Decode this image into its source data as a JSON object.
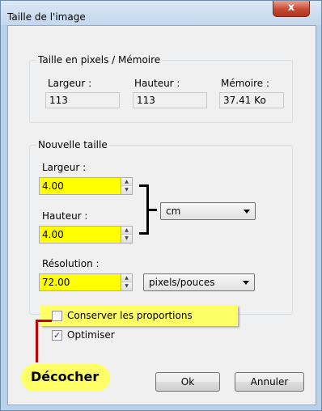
{
  "window": {
    "title": "Taille de l'image",
    "close_glyph": "x"
  },
  "pixels_group": {
    "legend": "Taille en pixels / Mémoire",
    "width_label": "Largeur :",
    "height_label": "Hauteur :",
    "memory_label": "Mémoire :",
    "width_value": "113",
    "height_value": "113",
    "memory_value": "37.41 Ko"
  },
  "new_size_group": {
    "legend": "Nouvelle taille",
    "width_label": "Largeur :",
    "width_value": "4.00",
    "height_label": "Hauteur :",
    "height_value": "4.00",
    "unit_selected": "cm",
    "resolution_label": "Résolution :",
    "resolution_value": "72.00",
    "resolution_unit_selected": "pixels/pouces"
  },
  "options": {
    "keep_proportions_label": "Conserver les proportions",
    "keep_proportions_checked": false,
    "optimize_label": "Optimiser",
    "optimize_checked": true
  },
  "callout": {
    "text": "Décocher",
    "highlight_color": "#ffff66",
    "line_color": "#c00000"
  },
  "buttons": {
    "ok_label": "Ok",
    "cancel_label": "Annuler"
  },
  "icons": {
    "spin_up": "▲",
    "spin_down": "▼",
    "check": "✓"
  }
}
